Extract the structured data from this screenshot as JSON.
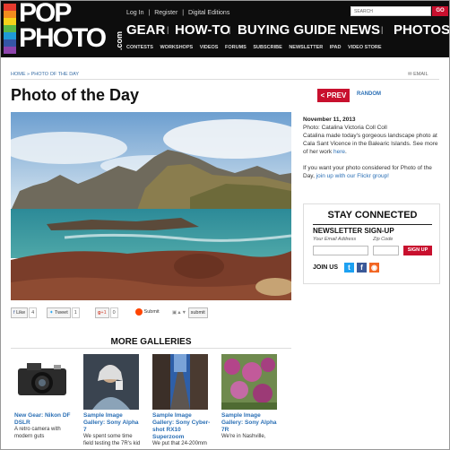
{
  "brand": {
    "logo_text_1": "POP",
    "logo_text_2": "PHOTO",
    "logo_suffix": ".com",
    "accent": "#c8102e",
    "link_color": "#2a6fb5"
  },
  "utility": {
    "login": "Log In",
    "sep": "|",
    "register": "Register",
    "digital": "Digital Editions"
  },
  "search": {
    "placeholder": "SEARCH",
    "button": "GO"
  },
  "mainnav": [
    "GEAR",
    "HOW-TO",
    "BUYING GUIDE",
    "NEWS",
    "PHOTOS"
  ],
  "subnav": [
    "CONTESTS",
    "WORKSHOPS",
    "VIDEOS",
    "FORUMS",
    "SUBSCRIBE",
    "NEWSLETTER",
    "IPAD",
    "VIDEO STORE"
  ],
  "breadcrumb": {
    "home": "HOME",
    "sep": "»",
    "current": "PHOTO OF THE DAY"
  },
  "email_link": "EMAIL",
  "page_title": "Photo of the Day",
  "pager": {
    "prev": "< PREV",
    "random": "RANDOM"
  },
  "photo_info": {
    "date": "November 11, 2013",
    "credit": "Photo: Catalina Victoria Coll Coll",
    "caption": "Catalina made today's gorgeous landscape photo at Cala Sant Vicence in the Balearic Islands. See more of her work",
    "caption_link": "here",
    "caption_end": ".",
    "submit_text": "If you want your photo considered for Photo of the Day,",
    "submit_link": "join up with our Flickr group!"
  },
  "stay_connected": {
    "title": "STAY CONNECTED",
    "newsletter": "NEWSLETTER SIGN-UP",
    "email_label": "Your Email Address",
    "zip_label": "Zip Code",
    "signup": "SIGN UP",
    "join": "JOIN US",
    "icons": [
      "twitter-icon",
      "facebook-icon",
      "rss-icon"
    ]
  },
  "share": {
    "like": "Like",
    "like_count": "4",
    "tweet": "Tweet",
    "tweet_count": "1",
    "gplus": "+1",
    "gplus_count": "0",
    "submit": "Submit",
    "stumble": "submit"
  },
  "more_galleries": {
    "heading": "MORE GALLERIES",
    "items": [
      {
        "title": "New Gear: Nikon DF DSLR",
        "desc": "A retro camera with modern guts"
      },
      {
        "title": "Sample Image Gallery: Sony Alpha 7",
        "desc": "We spent some time field testing the 7R's kid"
      },
      {
        "title": "Sample Image Gallery: Sony Cyber-shot RX10 Superzoom",
        "desc": "We put that 24-200mm"
      },
      {
        "title": "Sample Image Gallery: Sony Alpha 7R",
        "desc": "We're in Nashville,"
      }
    ]
  }
}
